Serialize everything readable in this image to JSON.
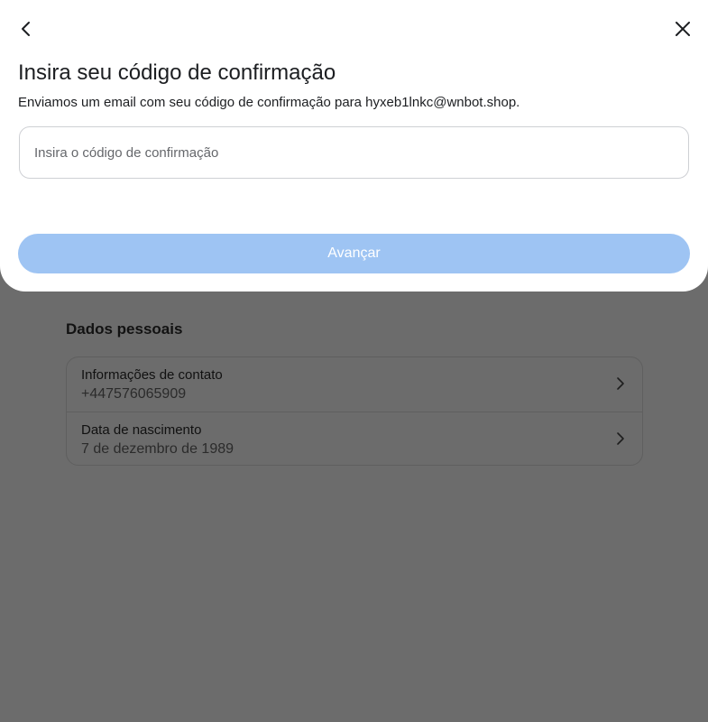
{
  "modal": {
    "title": "Insira seu código de confirmação",
    "description": "Enviamos um email com seu código de confirmação para hyxeb1lnkc@wnbot.shop.",
    "input_placeholder": "Insira o código de confirmação",
    "input_value": "",
    "next_label": "Avançar",
    "back_icon": "chevron-left-icon",
    "close_icon": "close-icon"
  },
  "personal_data": {
    "title": "Dados pessoais",
    "rows": [
      {
        "title": "Informações de contato",
        "value": "+447576065909"
      },
      {
        "title": "Data de nascimento",
        "value": "7 de dezembro de 1989"
      }
    ]
  },
  "colors": {
    "overlay": "#6c6c6c",
    "button_disabled": "#9ec4f3",
    "text_primary": "#1c1e21"
  }
}
